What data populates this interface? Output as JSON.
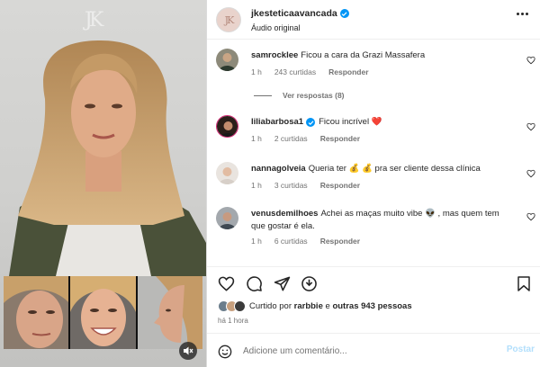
{
  "media": {
    "watermark": "JK",
    "mute_icon": "speaker-muted-icon"
  },
  "header": {
    "username": "jkesteticaavancada",
    "audio": "Áudio original",
    "avatar_text": "JK",
    "more_icon": "more-dots-icon"
  },
  "comments": [
    {
      "username": "samrocklee",
      "text": "Ficou a cara da Grazi Massafera",
      "time": "1 h",
      "likes": "243 curtidas",
      "reply": "Responder",
      "verified": false
    },
    {
      "username": "liliabarbosa1",
      "text": "Ficou incrível ❤️",
      "time": "1 h",
      "likes": "2 curtidas",
      "reply": "Responder",
      "verified": true
    },
    {
      "username": "nannagolveia",
      "text": "Queria ter 💰 💰 pra ser cliente dessa clínica",
      "time": "1 h",
      "likes": "3 curtidas",
      "reply": "Responder",
      "verified": false
    },
    {
      "username": "venusdemilhoes",
      "text": "Achei as maças muito vibe 👽 , mas quem tem que gostar é ela.",
      "time": "1 h",
      "likes": "6 curtidas",
      "reply": "Responder",
      "verified": false
    }
  ],
  "view_replies": "Ver respostas (8)",
  "likes": {
    "prefix": "Curtido por",
    "user": "rarbbie",
    "middle": "e",
    "others": "outras 943 pessoas"
  },
  "time_ago": "há 1 hora",
  "add_comment": {
    "placeholder": "Adicione um comentário...",
    "post_label": "Postar"
  },
  "colors": {
    "verified": "#0095f6",
    "heart": "#ff3040",
    "post_disabled": "#b2dffc",
    "muted_text": "#737373"
  }
}
